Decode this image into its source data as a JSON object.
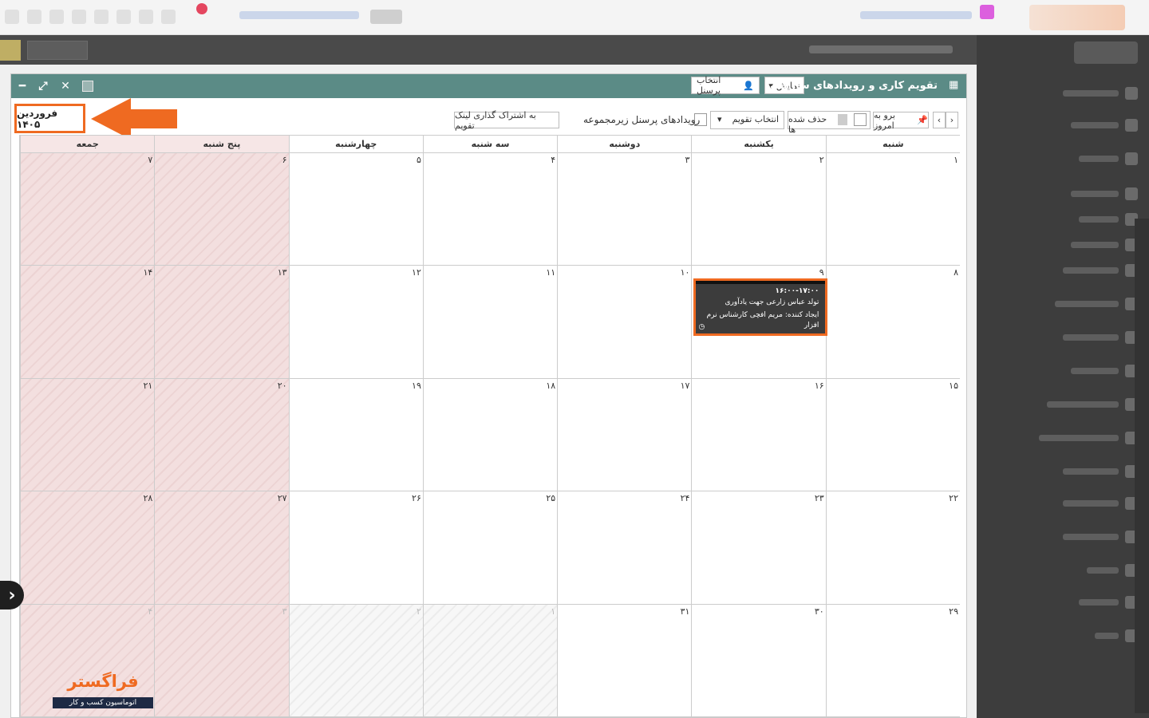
{
  "window": {
    "title": "تقویم کاری و رویدادهای سازمانی",
    "show_label": "نمایش",
    "select_personnel_label": "انتخاب پرسنل"
  },
  "toolbar": {
    "today_label": "برو به امروز",
    "deleted_label": "حذف شده ها",
    "select_calendar_label": "انتخاب تقویم",
    "sub_personnel_events_label": "رویدادهای پرسنل زیرمجموعه",
    "share_link_label": "به اشتراک گذاری لینک تقویم"
  },
  "month_title": "فروردین ۱۴۰۵",
  "weekdays": [
    "شنبه",
    "یکشنبه",
    "دوشنبه",
    "سه شنبه",
    "چهارشنبه",
    "پنج شنبه",
    "جمعه"
  ],
  "weeks": [
    [
      "۱",
      "۲",
      "۳",
      "۴",
      "۵",
      "۶",
      "۷"
    ],
    [
      "۸",
      "۹",
      "۱۰",
      "۱۱",
      "۱۲",
      "۱۳",
      "۱۴"
    ],
    [
      "۱۵",
      "۱۶",
      "۱۷",
      "۱۸",
      "۱۹",
      "۲۰",
      "۲۱"
    ],
    [
      "۲۲",
      "۲۳",
      "۲۴",
      "۲۵",
      "۲۶",
      "۲۷",
      "۲۸"
    ],
    [
      "۲۹",
      "۳۰",
      "۳۱",
      "۱",
      "۲",
      "۳",
      "۴"
    ]
  ],
  "event": {
    "time": "۱۶:۰۰-۱۷:۰۰",
    "title": "تولد عباس زارعی جهت یادآوری",
    "creator": "ایجاد کننده: مریم افچی کارشناس نرم",
    "creator_cont": "افزار"
  },
  "brand": {
    "name": "فراگستر",
    "tagline": "اتوماسیون کسب و کار"
  },
  "colors": {
    "header": "#5b8b86",
    "highlight": "#ef6a21",
    "weekend": "#f3dfdf",
    "event_bg": "#3c3c3c"
  }
}
